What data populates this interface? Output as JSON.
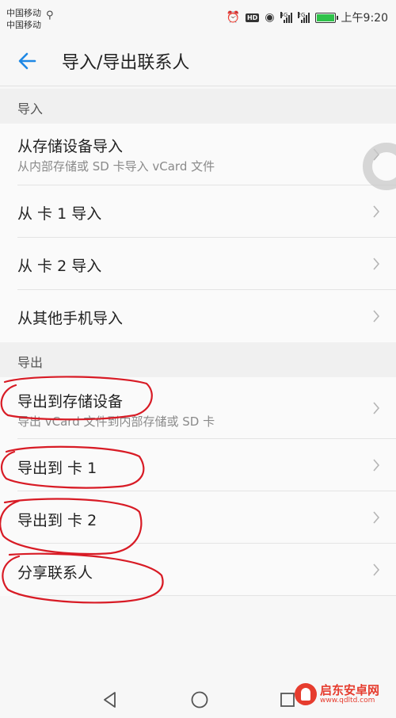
{
  "status_bar": {
    "carrier_1": "中国移动",
    "carrier_2": "中国移动",
    "net_1": "4G",
    "net_2": "2G",
    "hd_badge": "HD",
    "time": "上午9:20"
  },
  "app_bar": {
    "title": "导入/导出联系人"
  },
  "import_section": {
    "header": "导入",
    "items": [
      {
        "label": "从存储设备导入",
        "sublabel": "从内部存储或 SD 卡导入 vCard 文件"
      },
      {
        "label": "从 卡 1 导入"
      },
      {
        "label": "从 卡 2 导入"
      },
      {
        "label": "从其他手机导入"
      }
    ]
  },
  "export_section": {
    "header": "导出",
    "items": [
      {
        "label": "导出到存储设备",
        "sublabel": "导出 vCard 文件到内部存储或 SD 卡"
      },
      {
        "label": "导出到 卡 1"
      },
      {
        "label": "导出到 卡 2"
      },
      {
        "label": "分享联系人"
      }
    ]
  },
  "nav_bar": {
    "buttons": [
      "back-triangle-icon",
      "home-circle-icon",
      "recents-square-icon"
    ]
  },
  "watermark": {
    "name": "启东安卓网",
    "url": "www.qdltd.com"
  },
  "colors": {
    "accent": "#1e88e5",
    "annotation": "#d81b25",
    "battery": "#2fc24a"
  }
}
